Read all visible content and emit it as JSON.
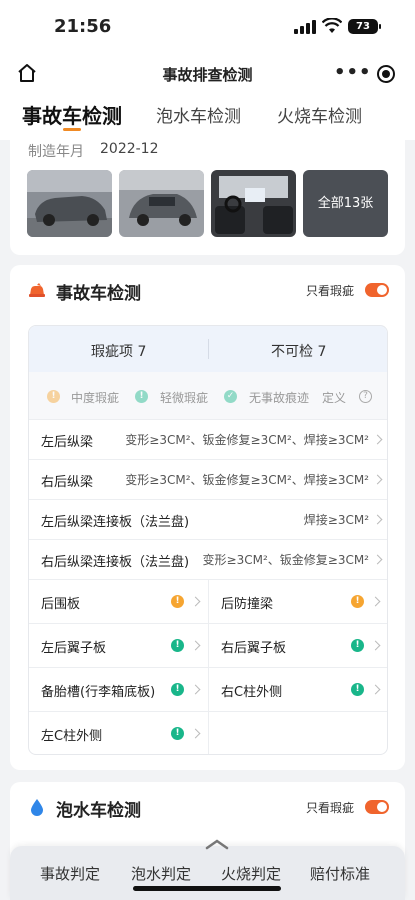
{
  "status": {
    "time": "21:56",
    "battery": "73"
  },
  "nav": {
    "title": "事故排查检测",
    "more": "•••"
  },
  "tabs": [
    "事故车检测",
    "泡水车检测",
    "火烧车检测"
  ],
  "vehicle": {
    "manufacture_label": "制造年月",
    "manufacture_value": "2022-12",
    "photo_more": "全部13张"
  },
  "accident": {
    "title": "事故车检测",
    "only_flaws": "只看瑕疵",
    "flaw_count_label": "瑕疵项 7",
    "uncheckable_label": "不可检 7",
    "legend": {
      "moderate": "中度瑕疵",
      "minor": "轻微瑕疵",
      "none": "无事故痕迹",
      "define": "定义"
    },
    "rows": [
      {
        "name": "左后纵梁",
        "detail": "变形≥3CM²、钣金修复≥3CM²、焊接≥3CM²"
      },
      {
        "name": "右后纵梁",
        "detail": "变形≥3CM²、钣金修复≥3CM²、焊接≥3CM²"
      },
      {
        "name": "左后纵梁连接板（法兰盘)",
        "detail": "焊接≥3CM²"
      },
      {
        "name": "右后纵梁连接板（法兰盘)",
        "detail": "变形≥3CM²、钣金修复≥3CM²"
      }
    ],
    "grid": [
      [
        "后围板",
        "后防撞梁"
      ],
      [
        "左后翼子板",
        "右后翼子板"
      ],
      [
        "备胎槽(行李箱底板)",
        "右C柱外侧"
      ],
      [
        "左C柱外侧",
        ""
      ]
    ]
  },
  "water": {
    "title": "泡水车检测",
    "only_flaws": "只看瑕疵"
  },
  "bottom": [
    "事故判定",
    "泡水判定",
    "火烧判定",
    "赔付标准"
  ],
  "colors": {
    "accent": "#f08a24",
    "toggle": "#f0642d",
    "moderate": "#f6a531",
    "minor": "#19b68a",
    "water": "#2f86e8"
  }
}
